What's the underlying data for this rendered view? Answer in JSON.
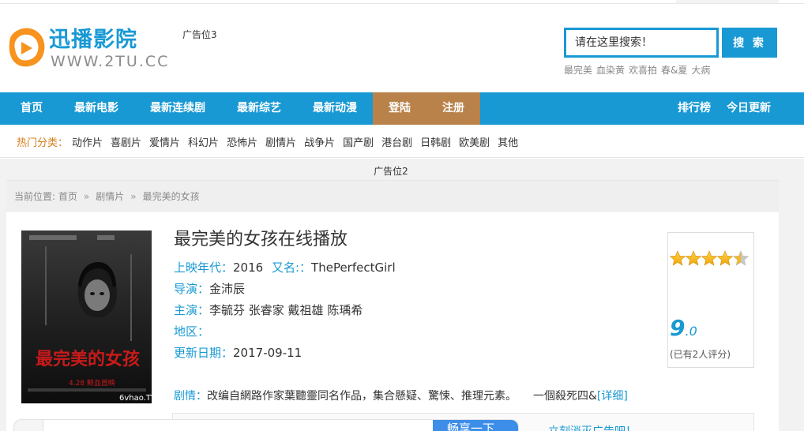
{
  "brand": {
    "name": "迅播影院",
    "domain": "WWW.2TU.CC",
    "accent": "#1899d4",
    "orange": "#f7931e"
  },
  "header": {
    "ad_slot": "广告位3",
    "search_placeholder": "请在这里搜索！",
    "search_button": "搜 索",
    "hot_keywords": [
      "最完美",
      "血染黄",
      "欢喜拍",
      "春&夏",
      "大病"
    ]
  },
  "nav": {
    "items": [
      "首页",
      "最新电影",
      "最新连续剧",
      "最新综艺",
      "最新动漫"
    ],
    "login": "登陆",
    "register": "注册",
    "right": [
      "排行榜",
      "今日更新"
    ]
  },
  "categories": {
    "label": "热门分类：",
    "items": [
      "动作片",
      "喜剧片",
      "爱情片",
      "科幻片",
      "恐怖片",
      "剧情片",
      "战争片",
      "国产剧",
      "港台剧",
      "日韩剧",
      "欧美剧",
      "其他"
    ]
  },
  "ad2": "广告位2",
  "breadcrumb": {
    "prefix": "当前位置:",
    "items": [
      "首页",
      "剧情片",
      "最完美的女孩"
    ]
  },
  "movie": {
    "title": "最完美的女孩在线播放",
    "year_label": "上映年代：",
    "year": "2016",
    "alias_label": "又名:：",
    "alias": "ThePerfectGirl",
    "director_label": "导演：",
    "director": "金沛辰",
    "cast_label": "主演：",
    "cast": "李毓芬 张睿家 戴祖雄 陈瑀希",
    "region_label": "地区：",
    "region": "",
    "updated_label": "更新日期：",
    "updated": "2017-09-11",
    "plot_label": "剧情：",
    "plot": "改编自網路作家葉聽靈同名作品，集合懸疑、驚悚、推理元素。　　一個殺死四&",
    "plot_more": "[详细]",
    "poster": {
      "title_text": "最完美的女孩",
      "date_text": "4.28 鮮血首映",
      "watermark": "6vhao.TV"
    }
  },
  "rating": {
    "stars": 4.5,
    "score_int": "9",
    "score_dec": ".0",
    "votes": "(已有2人评分)"
  },
  "bottom_bar": {
    "button": "畅享一下",
    "link": "立刻消灭广告吧！"
  }
}
